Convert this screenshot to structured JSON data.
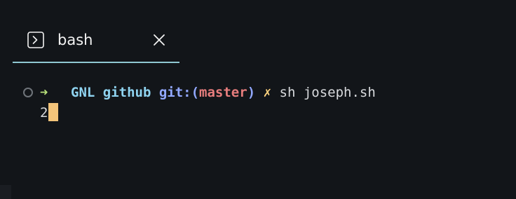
{
  "tab": {
    "label": "bash",
    "icon": "terminal-prompt-icon",
    "close_icon": "close-icon"
  },
  "terminal": {
    "prompt": {
      "arrow": "➜",
      "directory": "GNL github",
      "git_label": "git:(",
      "branch": "master",
      "git_close": ")",
      "dirty_marker": "✗",
      "command": "sh joseph.sh"
    },
    "output": "2"
  },
  "colors": {
    "background": "#121519",
    "tab_underline": "#8fc7d2",
    "arrow": "#b7e07a",
    "directory": "#8fd3f0",
    "git_label": "#92a8ff",
    "branch": "#e77d7d",
    "dirty_marker": "#ffd37f",
    "cursor": "#f3c47a"
  }
}
